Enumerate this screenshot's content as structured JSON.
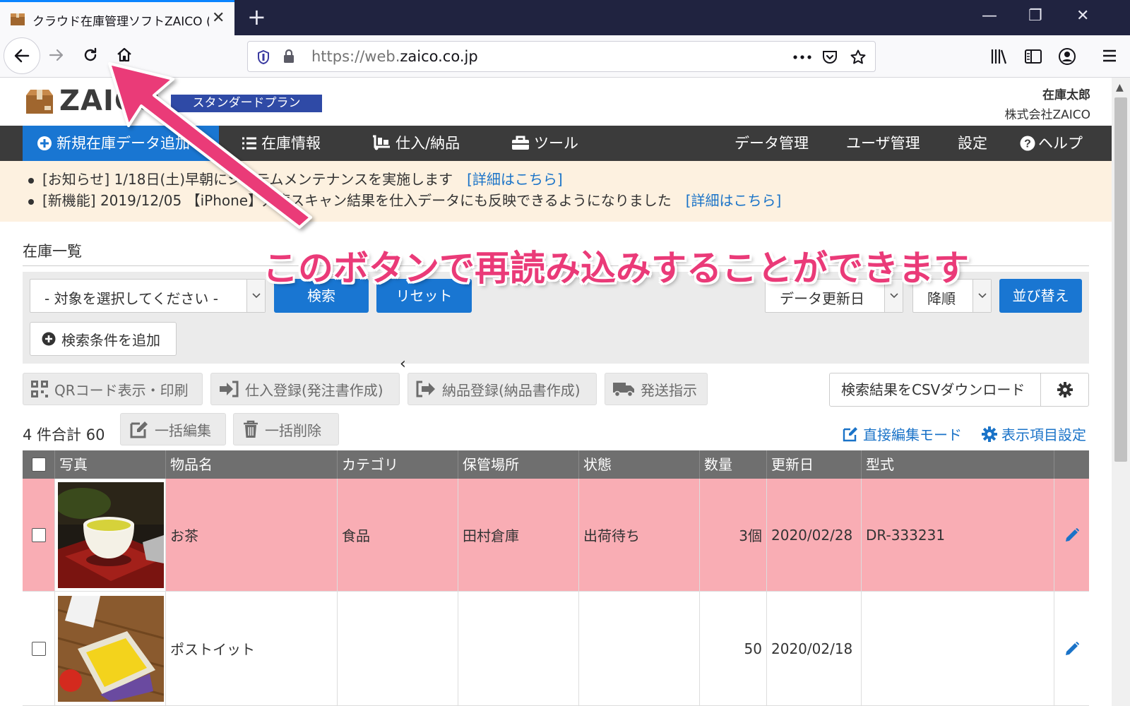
{
  "browser": {
    "tab_title": "クラウド在庫管理ソフトZAICO (ス",
    "url_prefix": "https://web.",
    "url_domain": "zaico.co.jp",
    "window_controls": {
      "minimize": "—",
      "restore": "❐",
      "close": "✕"
    },
    "new_tab": "+",
    "tab_close": "✕"
  },
  "header": {
    "logo": "ZAICO",
    "plan": "スタンダードプラン",
    "user_name": "在庫太郎",
    "company": "株式会社ZAICO"
  },
  "menu": {
    "new_item": "新規在庫データ追加",
    "inventory": "在庫情報",
    "purchase": "仕入/納品",
    "tools": "ツール",
    "data_mgmt": "データ管理",
    "user_mgmt": "ユーザ管理",
    "settings": "設定",
    "help": "ヘルプ"
  },
  "notices": [
    {
      "text": "[お知らせ] 1/18日(土)早朝にシステムメンテナンスを実施します",
      "link": "[詳細はこちら]"
    },
    {
      "text": "[新機能] 2019/12/05 【iPhone】入庫スキャン結果を仕入データにも反映できるようになりました",
      "link": "[詳細はこちら]"
    }
  ],
  "list": {
    "title": "在庫一覧",
    "filter_placeholder": "- 対象を選択してください -",
    "search": "検索",
    "reset": "リセット",
    "sort_field": "データ更新日",
    "sort_order": "降順",
    "sort_button": "並び替え",
    "add_condition": "検索条件を追加"
  },
  "actions": {
    "qr": "QRコード表示・印刷",
    "purchase_reg": "仕入登録(発注書作成)",
    "delivery_reg": "納品登録(納品書作成)",
    "shipping": "発送指示",
    "csv": "検索結果をCSVダウンロード",
    "count": "4 件合計 60",
    "bulk_edit": "一括編集",
    "bulk_delete": "一括削除",
    "direct_edit": "直接編集モード",
    "column_settings": "表示項目設定"
  },
  "table": {
    "columns": [
      "写真",
      "物品名",
      "カテゴリ",
      "保管場所",
      "状態",
      "数量",
      "更新日",
      "型式"
    ],
    "rows": [
      {
        "name": "お茶",
        "category": "食品",
        "location": "田村倉庫",
        "status": "出荷待ち",
        "quantity": "3個",
        "updated": "2020/02/28",
        "model": "DR-333231",
        "highlight": "#f9adb4"
      },
      {
        "name": "ポストイット",
        "category": "",
        "location": "",
        "status": "",
        "quantity": "50",
        "updated": "2020/02/18",
        "model": "",
        "highlight": "#ffffff"
      }
    ]
  },
  "annotation": {
    "text": "このボタンで再読み込みすることができます",
    "color": "#ea3a78"
  },
  "colors": {
    "primary": "#1976d2",
    "menubar": "#3b3b3b",
    "plan_badge": "#2f4aa6",
    "notice_bg": "#fdf1e0"
  }
}
